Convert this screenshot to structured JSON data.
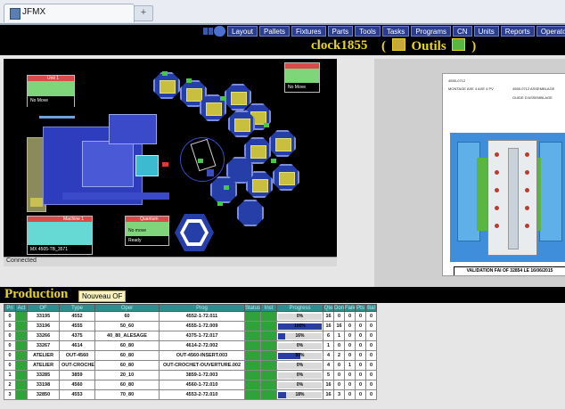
{
  "browser": {
    "tab_title": "JFMX",
    "new_tab_symbol": "+"
  },
  "nav": {
    "buttons": [
      "Layout",
      "Pallets",
      "Fixtures",
      "Parts",
      "Tools",
      "Tasks",
      "Programs",
      "CN",
      "Units",
      "Reports",
      "Operators"
    ]
  },
  "header": {
    "clock": "clock1855",
    "outils_label": "Outils",
    "paren_open": "(",
    "paren_close": ")"
  },
  "layout_panel": {
    "panel_topleft": {
      "title": "Unit 1",
      "text": "No Move"
    },
    "panel_topright": {
      "title": "",
      "text": "No Move"
    },
    "panel_bottomleft": {
      "title": "Machine 1",
      "text": "MX 4505-TB_3571"
    },
    "panel_bottomright": {
      "title": "Quantum",
      "text1": "No move",
      "text2": "Ready"
    },
    "status": "Connected"
  },
  "document": {
    "header_left": "4555-0712",
    "header_right_1": "4555-0712 ASSEMBLAGE",
    "header_right_2": "GUIDE D'ASSEMBLAGE",
    "subtitle": "MONTAGE AXE 4 AXE 4 PV",
    "validation": "VALIDATION FAI OF 32854 LE 16/06/2015"
  },
  "production": {
    "title": "Production",
    "new_button": "Nouveau OF",
    "columns": [
      "Pri",
      "Act",
      "OF",
      "Type",
      "Oper",
      "Prog",
      "Status",
      "Inst",
      "Progress",
      "Qte",
      "Done",
      "Failed",
      "Pts",
      "Bal"
    ],
    "rows": [
      {
        "pri": "0",
        "of": "33195",
        "type": "4552",
        "oper": "60",
        "prog": "4552-1-72.011",
        "progress": 0,
        "qte": "16",
        "done": "0",
        "failed": "0",
        "pts": "0",
        "bal": "0"
      },
      {
        "pri": "0",
        "of": "33196",
        "type": "4555",
        "oper": "50_60",
        "prog": "4555-1-72.009",
        "progress": 100,
        "qte": "16",
        "done": "16",
        "failed": "0",
        "pts": "0",
        "bal": "0"
      },
      {
        "pri": "0",
        "of": "33266",
        "type": "4375",
        "oper": "40_80_ALESAGE",
        "prog": "4375-1-72.017",
        "progress": 16,
        "qte": "6",
        "done": "1",
        "failed": "0",
        "pts": "0",
        "bal": "0"
      },
      {
        "pri": "0",
        "of": "33267",
        "type": "4614",
        "oper": "60_80",
        "prog": "4614-2-72.002",
        "progress": 0,
        "qte": "1",
        "done": "0",
        "failed": "0",
        "pts": "0",
        "bal": "0"
      },
      {
        "pri": "0",
        "of": "ATELIER",
        "type": "OUT-4560",
        "oper": "60_80",
        "prog": "OUT-4560-INSERT.003",
        "progress": 50,
        "qte": "4",
        "done": "2",
        "failed": "0",
        "pts": "0",
        "bal": "0"
      },
      {
        "pri": "0",
        "of": "ATELIER",
        "type": "OUT-CROCHET",
        "oper": "60_80",
        "prog": "OUT-CROCHET-OUVERTURE.002",
        "progress": 0,
        "qte": "4",
        "done": "0",
        "failed": "1",
        "pts": "0",
        "bal": "0"
      },
      {
        "pri": "1",
        "of": "33285",
        "type": "3859",
        "oper": "20_10",
        "prog": "3859-1-72.003",
        "progress": 0,
        "qte": "5",
        "done": "0",
        "failed": "0",
        "pts": "0",
        "bal": "0"
      },
      {
        "pri": "2",
        "of": "33198",
        "type": "4560",
        "oper": "60_80",
        "prog": "4560-1-72.010",
        "progress": 0,
        "qte": "16",
        "done": "0",
        "failed": "0",
        "pts": "0",
        "bal": "0"
      },
      {
        "pri": "3",
        "of": "32850",
        "type": "4553",
        "oper": "70_80",
        "prog": "4553-2-72.010",
        "progress": 18,
        "qte": "16",
        "done": "3",
        "failed": "0",
        "pts": "0",
        "bal": "0"
      }
    ]
  },
  "colors": {
    "accent_yellow": "#e9d51a",
    "nav_blue": "#2a3d8f",
    "status_green": "#2fa33a",
    "progress_blue": "#2a3da1",
    "header_teal": "#2b8f8f"
  }
}
